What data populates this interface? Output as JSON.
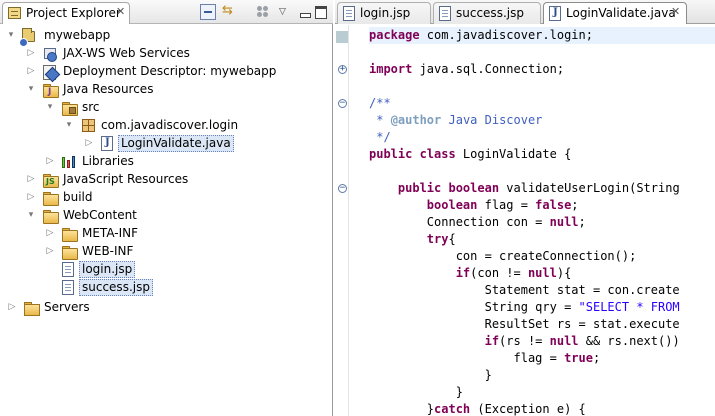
{
  "explorer": {
    "title": "Project Explorer",
    "close_glyph": "✕",
    "toolbar": {
      "collapse_all": "collapse-all-icon",
      "link_editor": "link-with-editor-icon",
      "view_menu_glyph": "▽"
    },
    "tree": [
      {
        "label": "mywebapp",
        "depth": 0,
        "icon": "project-icon",
        "twisty": "▾"
      },
      {
        "label": "JAX-WS Web Services",
        "depth": 1,
        "icon": "webservices-icon",
        "twisty": "▷"
      },
      {
        "label": "Deployment Descriptor: mywebapp",
        "depth": 1,
        "icon": "deployment-descriptor-icon",
        "twisty": "▷"
      },
      {
        "label": "Java Resources",
        "depth": 1,
        "icon": "java-resources-icon",
        "twisty": "▾"
      },
      {
        "label": "src",
        "depth": 2,
        "icon": "source-folder-icon",
        "twisty": "▾"
      },
      {
        "label": "com.javadiscover.login",
        "depth": 3,
        "icon": "package-icon",
        "twisty": "▾"
      },
      {
        "label": "LoginValidate.java",
        "depth": 4,
        "icon": "java-file-icon",
        "twisty": "▷",
        "selected": true
      },
      {
        "label": "Libraries",
        "depth": 2,
        "icon": "libraries-icon",
        "twisty": "▷"
      },
      {
        "label": "JavaScript Resources",
        "depth": 1,
        "icon": "javascript-resources-icon",
        "twisty": "▷"
      },
      {
        "label": "build",
        "depth": 1,
        "icon": "folder-icon",
        "twisty": "▷"
      },
      {
        "label": "WebContent",
        "depth": 1,
        "icon": "folder-icon",
        "twisty": "▾"
      },
      {
        "label": "META-INF",
        "depth": 2,
        "icon": "folder-icon",
        "twisty": "▷"
      },
      {
        "label": "WEB-INF",
        "depth": 2,
        "icon": "folder-icon",
        "twisty": "▷"
      },
      {
        "label": "login.jsp",
        "depth": 2,
        "icon": "jsp-file-icon",
        "twisty": "",
        "selected": true
      },
      {
        "label": "success.jsp",
        "depth": 2,
        "icon": "jsp-file-icon",
        "twisty": "",
        "selected": true
      },
      {
        "label": "Servers",
        "depth": 0,
        "icon": "servers-folder-icon",
        "twisty": "▷"
      }
    ]
  },
  "editor": {
    "tabs": [
      {
        "label": "login.jsp",
        "icon": "jsp-file-icon",
        "active": false
      },
      {
        "label": "success.jsp",
        "icon": "jsp-file-icon",
        "active": false
      },
      {
        "label": "LoginValidate.java",
        "icon": "java-file-icon",
        "active": true,
        "close": "✕"
      }
    ],
    "code": {
      "l1": "package com.javadiscover.login;",
      "l3": "import java.sql.Connection;",
      "l5": "/**",
      "l6a": " * ",
      "l6b": "@author",
      "l6c": " Java Discover",
      "l7": " */",
      "l8a": "public class",
      "l8b": " LoginValidate {",
      "l10a": "    public boolean",
      "l10b": " validateUserLogin(String",
      "l11a": "        boolean",
      "l11b": " flag = ",
      "l11c": "false",
      "l11d": ";",
      "l12a": "        Connection con = ",
      "l12b": "null",
      "l12c": ";",
      "l13a": "        try",
      "l13b": "{",
      "l14": "            con = createConnection();",
      "l15a": "            if",
      "l15b": "(con != ",
      "l15c": "null",
      "l15d": "){",
      "l16": "                Statement stat = con.create",
      "l17a": "                String qry = ",
      "l17b": "\"SELECT * FROM",
      "l18": "                ResultSet rs = stat.execute",
      "l19a": "                if",
      "l19b": "(rs != ",
      "l19c": "null",
      "l19d": " && rs.next())",
      "l20a": "                    flag = ",
      "l20b": "true",
      "l20c": ";",
      "l21": "                }",
      "l22": "            }",
      "l23a": "        }",
      "l23b": "catch",
      "l23c": " (Exception e) {"
    }
  },
  "colors": {
    "keyword": "#7f0055",
    "comment": "#3f5fbf",
    "string": "#2a00ff",
    "selection": "#dbe7f6"
  }
}
